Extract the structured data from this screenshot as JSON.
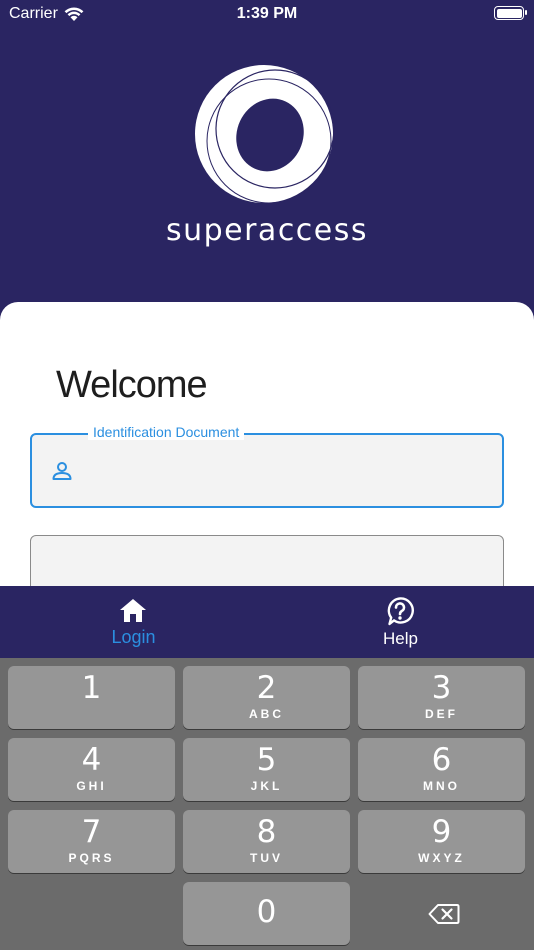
{
  "status_bar": {
    "carrier": "Carrier",
    "time": "1:39 PM"
  },
  "brand": {
    "name": "superaccess"
  },
  "login_card": {
    "title": "Welcome",
    "id_field": {
      "label": "Identification Document",
      "value": ""
    }
  },
  "tabs": [
    {
      "label": "Login",
      "icon": "home-icon",
      "active": true
    },
    {
      "label": "Help",
      "icon": "help-icon",
      "active": false
    }
  ],
  "keypad": {
    "keys": [
      {
        "digit": "1",
        "letters": ""
      },
      {
        "digit": "2",
        "letters": "ABC"
      },
      {
        "digit": "3",
        "letters": "DEF"
      },
      {
        "digit": "4",
        "letters": "GHI"
      },
      {
        "digit": "5",
        "letters": "JKL"
      },
      {
        "digit": "6",
        "letters": "MNO"
      },
      {
        "digit": "7",
        "letters": "PQRS"
      },
      {
        "digit": "8",
        "letters": "TUV"
      },
      {
        "digit": "9",
        "letters": "WXYZ"
      },
      {
        "digit": "0",
        "letters": ""
      }
    ]
  },
  "colors": {
    "brand": "#2a2562",
    "accent": "#2b8fe0",
    "key": "#969696",
    "keypad_bg": "#6b6b6b"
  }
}
